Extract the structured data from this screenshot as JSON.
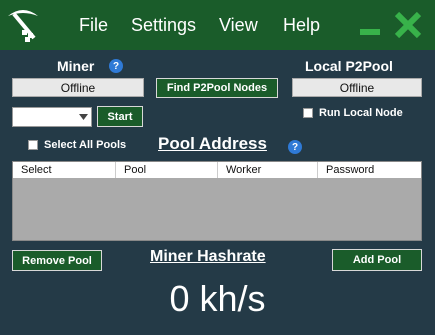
{
  "menu": {
    "file": "File",
    "settings": "Settings",
    "view": "View",
    "help": "Help"
  },
  "miner": {
    "label": "Miner",
    "status": "Offline",
    "device_value": "",
    "start": "Start"
  },
  "find_nodes": "Find P2Pool Nodes",
  "local_p2pool": {
    "label": "Local P2Pool",
    "status": "Offline",
    "run_local": "Run Local Node"
  },
  "pools": {
    "select_all": "Select All Pools",
    "title": "Pool Address",
    "columns": [
      "Select",
      "Pool",
      "Worker",
      "Password"
    ],
    "rows": []
  },
  "remove_pool": "Remove Pool",
  "add_pool": "Add Pool",
  "hashrate": {
    "label": "Miner Hashrate",
    "value": "0 kh/s"
  },
  "colors": {
    "background": "#243a47",
    "titlebar": "#1a5c2a",
    "accent_green": "#38b24a",
    "help_blue": "#2f7ad6"
  },
  "icons": [
    "pickaxe-logo-icon",
    "help-icon",
    "minimize-icon",
    "close-icon",
    "dropdown-arrow-icon"
  ]
}
